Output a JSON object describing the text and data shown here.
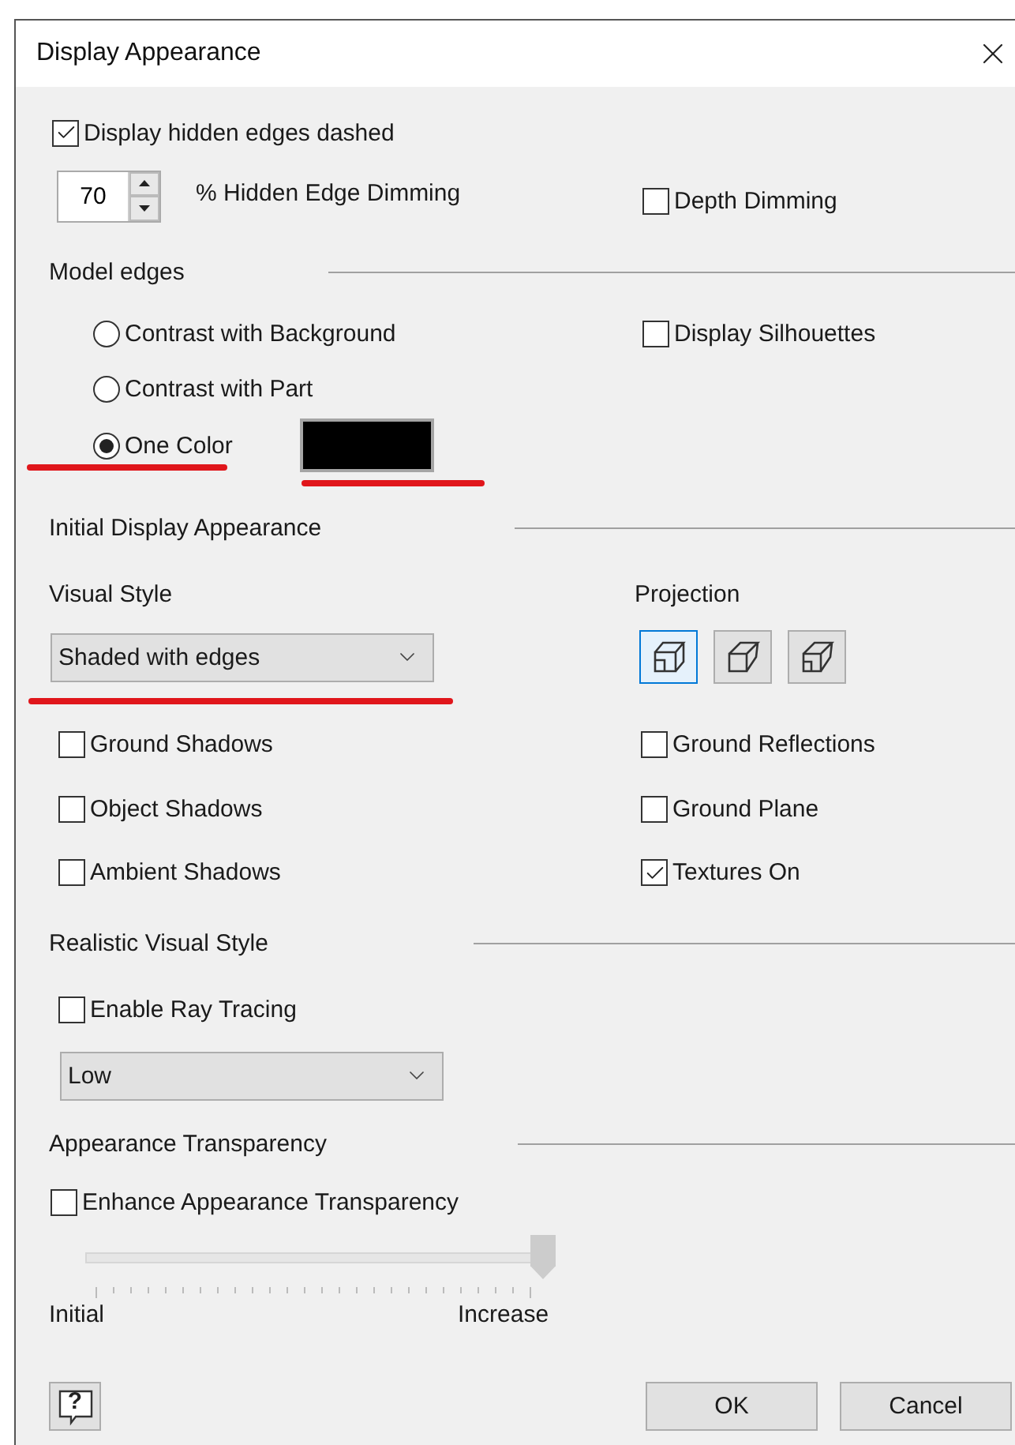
{
  "window": {
    "title": "Display Appearance"
  },
  "hidden_edges": {
    "label": "Display hidden edges dashed",
    "checked": true
  },
  "dimming": {
    "value": "70",
    "label": "% Hidden Edge Dimming"
  },
  "depth_dimming": {
    "label": "Depth Dimming",
    "checked": false
  },
  "model_edges": {
    "heading": "Model edges",
    "options": [
      {
        "label": "Contrast with Background",
        "selected": false,
        "underlined": false
      },
      {
        "label": "Contrast with Part",
        "selected": false,
        "underlined": false
      },
      {
        "label": "One Color",
        "selected": true,
        "underlined": true
      }
    ],
    "swatch": {
      "color": "#000000",
      "underlined": true
    },
    "silhouettes": {
      "label": "Display Silhouettes",
      "checked": false
    }
  },
  "initial_display": {
    "heading": "Initial Display Appearance",
    "visual_style": {
      "label": "Visual Style",
      "value": "Shaded with edges",
      "underlined": true
    },
    "projection": {
      "label": "Projection",
      "options": [
        {
          "kind": "orthographic",
          "selected": true
        },
        {
          "kind": "perspective",
          "selected": false
        },
        {
          "kind": "mixed",
          "selected": false
        }
      ]
    },
    "options": [
      {
        "label": "Ground Shadows",
        "checked": false
      },
      {
        "label": "Ground Reflections",
        "checked": false
      },
      {
        "label": "Object Shadows",
        "checked": false
      },
      {
        "label": "Ground Plane",
        "checked": false
      },
      {
        "label": "Ambient Shadows",
        "checked": false
      },
      {
        "label": "Textures On",
        "checked": true
      }
    ]
  },
  "realistic": {
    "heading": "Realistic Visual Style",
    "ray_tracing": {
      "label": "Enable Ray Tracing",
      "checked": false
    },
    "quality": {
      "value": "Low"
    }
  },
  "transparency": {
    "heading": "Appearance Transparency",
    "enhance": {
      "label": "Enhance Appearance Transparency",
      "checked": false
    },
    "slider": {
      "level": 1,
      "disabled": true,
      "min_label": "Initial",
      "max_label": "Increase"
    }
  },
  "help_button": {
    "symbol": "?"
  },
  "buttons": [
    {
      "label": "OK"
    },
    {
      "label": "Cancel"
    }
  ]
}
